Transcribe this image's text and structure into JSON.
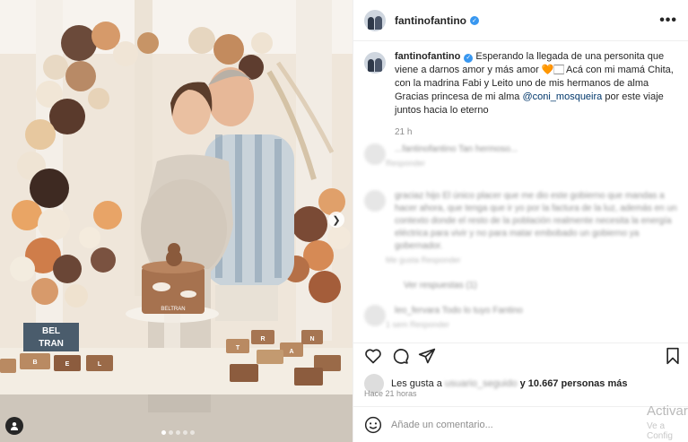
{
  "post": {
    "username": "fantinofantino",
    "caption_part1": "Esperando la llegada de una personita que viene a darnos amor y más amor ",
    "caption_heart": "🧡",
    "caption_part2": "🏻 Acá con mi mamá Chita, con la madrina Fabi y Leito uno de mis hermanos de alma Gracias princesa de mi alma ",
    "caption_mention": "@coni_mosqueira",
    "caption_part3": " por este viaje juntos hacia lo eterno",
    "time_short": "21 h",
    "more_label": "•••"
  },
  "cake": {
    "name": "BELTRAN",
    "blocks_top": "BEL",
    "blocks_bottom": "TRAN",
    "cookie_letters": [
      "B",
      "E",
      "L",
      "T",
      "R",
      "A",
      "N"
    ]
  },
  "comments": [
    {
      "text": "...fantinofantino Tan hermoso...",
      "meta": "Responder"
    },
    {
      "text": "graciaz hijo El único placer que me dio este gobierno que mandas a hacer ahora, que tenga que ir yo por la factura de la luz, además en un contexto donde el resto de la población realmente necesita la energía eléctrica para vivir y no para matar embobado un gobierno ya gobernador.",
      "meta": "Me gusta Responder"
    },
    {
      "text": "Ver respuestas (1)",
      "meta": ""
    },
    {
      "text": "leo_fervara Todo lo tuyo Fantino",
      "meta": "1 sem Responder"
    }
  ],
  "likes": {
    "prefix": "Les gusta a",
    "hidden_user": "usuario_seguido",
    "suffix_bold": "y 10.667 personas más"
  },
  "time_full": "Hace 21 horas",
  "add_comment_placeholder": "Añade un comentario...",
  "watermark": {
    "title": "Activar",
    "sub": "Ve a Config"
  },
  "colors": {
    "verified": "#3897f0",
    "mention": "#00376b",
    "heart": "#e07d2b"
  }
}
